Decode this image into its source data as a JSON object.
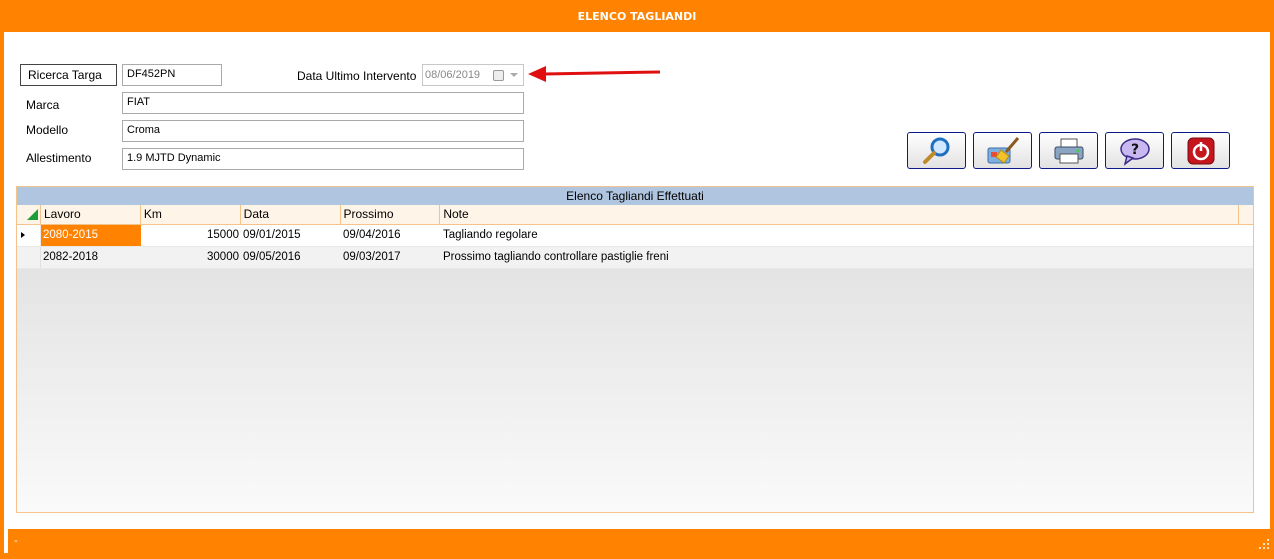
{
  "window": {
    "title": "ELENCO TAGLIANDI"
  },
  "form": {
    "ricerca_label": "Ricerca Targa",
    "targa_value": "DF452PN",
    "data_label": "Data Ultimo Intervento",
    "data_value": "08/06/2019",
    "marca_label": "Marca",
    "marca_value": "FIAT",
    "modello_label": "Modello",
    "modello_value": "Croma",
    "allestimento_label": "Allestimento",
    "allestimento_value": "1.9 MJTD Dynamic"
  },
  "toolbar": {
    "buttons": [
      {
        "icon": "search-icon"
      },
      {
        "icon": "broom-clear-icon"
      },
      {
        "icon": "printer-icon"
      },
      {
        "icon": "help-icon"
      },
      {
        "icon": "power-exit-icon"
      }
    ]
  },
  "grid": {
    "caption": "Elenco Tagliandi Effettuati",
    "columns": [
      "Lavoro",
      "Km",
      "Data",
      "Prossimo",
      "Note"
    ],
    "rows": [
      {
        "lavoro": "2080-2015",
        "km": "15000",
        "data": "09/01/2015",
        "prossimo": "09/04/2016",
        "note": "Tagliando regolare"
      },
      {
        "lavoro": "2082-2018",
        "km": "30000",
        "data": "09/05/2016",
        "prossimo": "09/03/2017",
        "note": "Prossimo tagliando controllare pastiglie freni"
      }
    ]
  },
  "status": {
    "text": "-"
  },
  "colors": {
    "accent": "#ff8200",
    "caption_bg": "#b0c6e0",
    "arrow": "#e01010"
  }
}
